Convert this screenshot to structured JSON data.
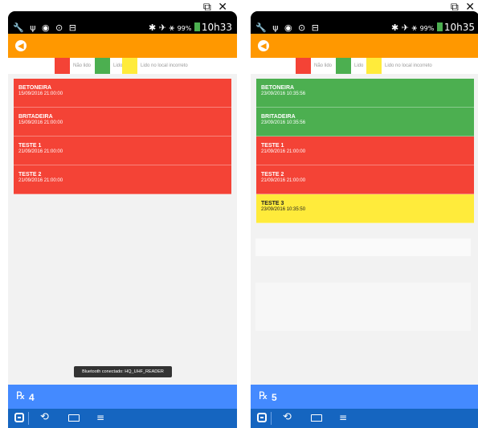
{
  "status_bar": {
    "left_icons": "🔧 ψ ◉ ⊙ ⊟",
    "right_icons": "✱ ✈ ⚹",
    "battery": "99%"
  },
  "screens": [
    {
      "time": "10h33",
      "legend": {
        "not_read": "Não lido",
        "read": "Lido",
        "wrong_place": "Lido no local incorreto"
      },
      "items": [
        {
          "title": "BETONEIRA",
          "date": "15/09/2016 21:00:00",
          "status": "red"
        },
        {
          "title": "BRITADEIRA",
          "date": "15/09/2016 21:00:00",
          "status": "red"
        },
        {
          "title": "TESTE 1",
          "date": "21/09/2016 21:00:00",
          "status": "red"
        },
        {
          "title": "TESTE 2",
          "date": "21/09/2016 21:00:00",
          "status": "red"
        }
      ],
      "toast": "Bluetooth conectado: HQ_UHF_READER",
      "count_icon": "℞",
      "count": "4"
    },
    {
      "time": "10h35",
      "legend": {
        "not_read": "Não lido",
        "read": "Lido",
        "wrong_place": "Lido no local incorreto"
      },
      "items": [
        {
          "title": "BETONEIRA",
          "date": "23/09/2016 10:35:56",
          "status": "green"
        },
        {
          "title": "BRITADEIRA",
          "date": "23/09/2016 10:35:56",
          "status": "green"
        },
        {
          "title": "TESTE 1",
          "date": "21/09/2016 21:00:00",
          "status": "red"
        },
        {
          "title": "TESTE 2",
          "date": "21/09/2016 21:00:00",
          "status": "red"
        },
        {
          "title": "TESTE 3",
          "date": "23/09/2016 10:35:50",
          "status": "yellow"
        }
      ],
      "count_icon": "℞",
      "count": "5"
    }
  ],
  "colors": {
    "orange_toolbar": "#ff9800",
    "not_read": "#f44336",
    "read": "#4caf50",
    "wrong_place": "#ffeb3b",
    "bottom_bar": "#448aff",
    "nav_bar": "#1565c0"
  },
  "nav": {
    "back_icon": "⟲",
    "home_icon": "⌂",
    "menu_icon": "≡"
  }
}
